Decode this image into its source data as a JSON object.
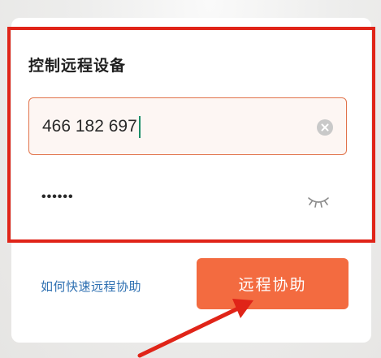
{
  "dialog": {
    "title": "控制远程设备",
    "device_id": {
      "value": "466 182 697"
    },
    "password": {
      "masked_value": "••••••"
    },
    "help_link": "如何快速远程协助",
    "assist_button": "远程协助"
  },
  "icons": {
    "clear": "clear-circle-icon",
    "password_visibility": "eye-closed-icon"
  },
  "colors": {
    "accent": "#f36b40",
    "annotation_red": "#e02418",
    "link": "#2d6fb1",
    "caret": "#1c8f6a"
  }
}
